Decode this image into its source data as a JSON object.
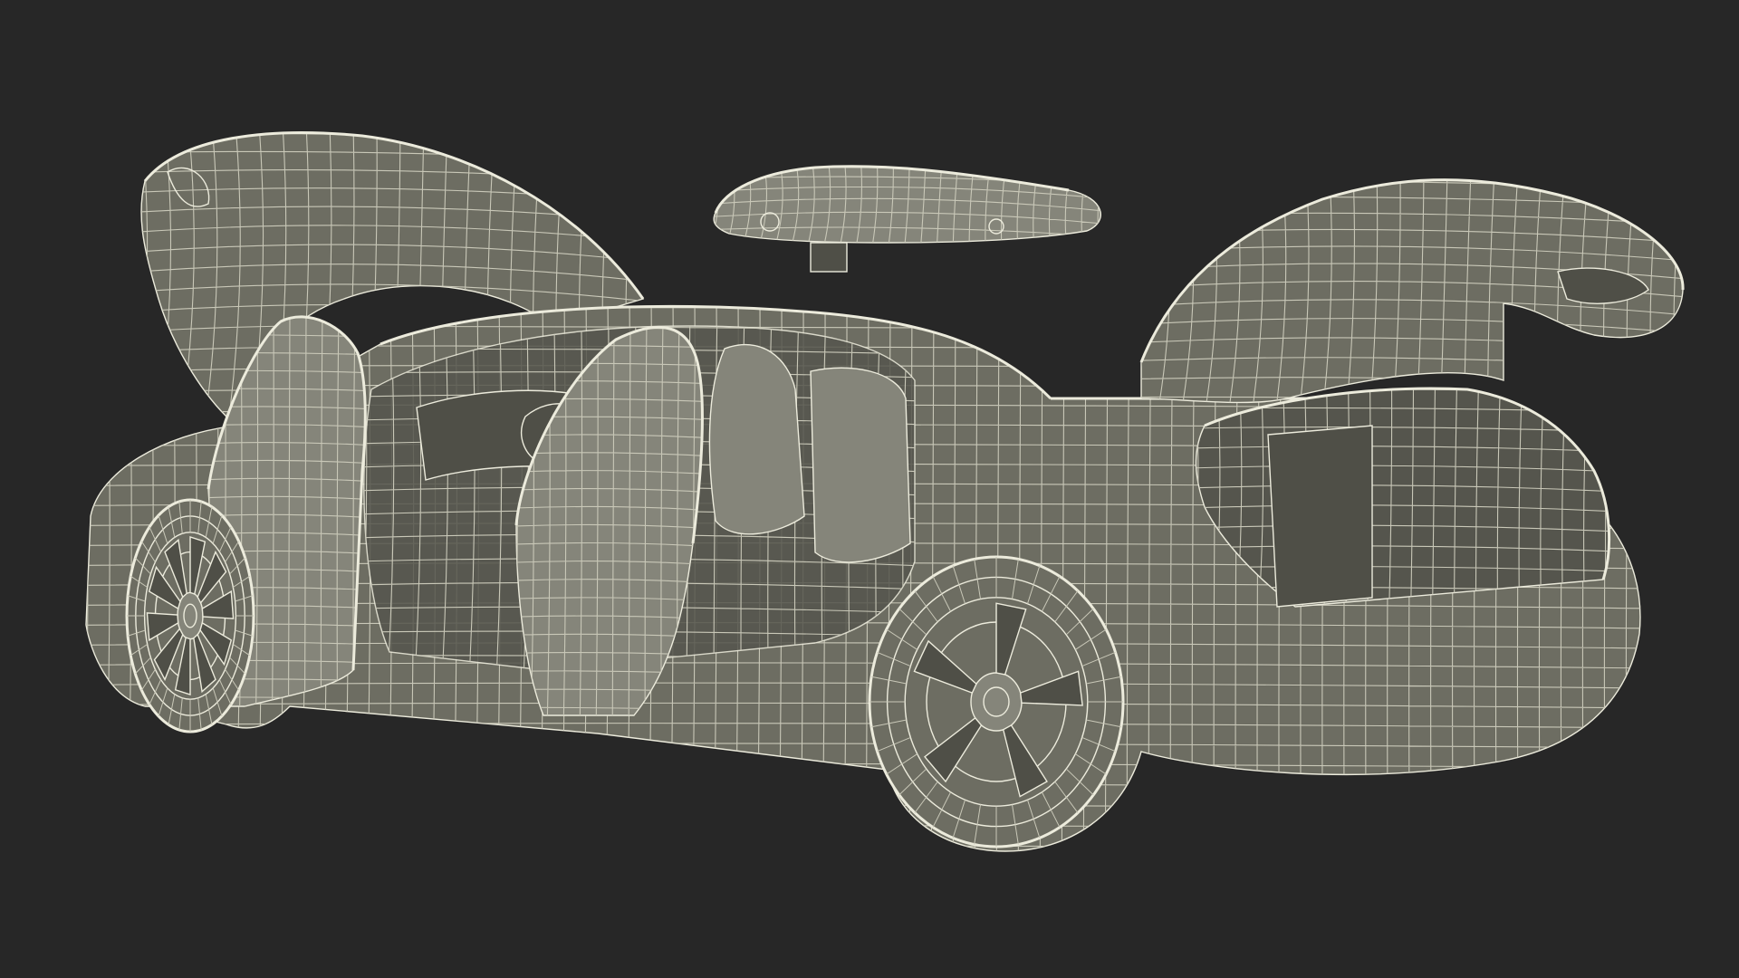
{
  "scene": {
    "subject": "wireframe-sedan-open-doors",
    "view": "rear-three-quarter",
    "colors": {
      "background": "#272727",
      "shell": "#6d6d62",
      "shell_light": "#85857a",
      "shell_dark": "#4f4f47",
      "interior": "#55554d",
      "wire": "#ecebdc",
      "wire_dim": "#c9c8b8"
    },
    "parts": [
      "body",
      "roof",
      "roof-rack-box",
      "hood-open",
      "trunk-lid-open",
      "front-left-door-open",
      "rear-left-door-open",
      "trunk-cavity",
      "front-wheel",
      "rear-wheel",
      "rear-bumper",
      "seats",
      "dashboard"
    ]
  }
}
